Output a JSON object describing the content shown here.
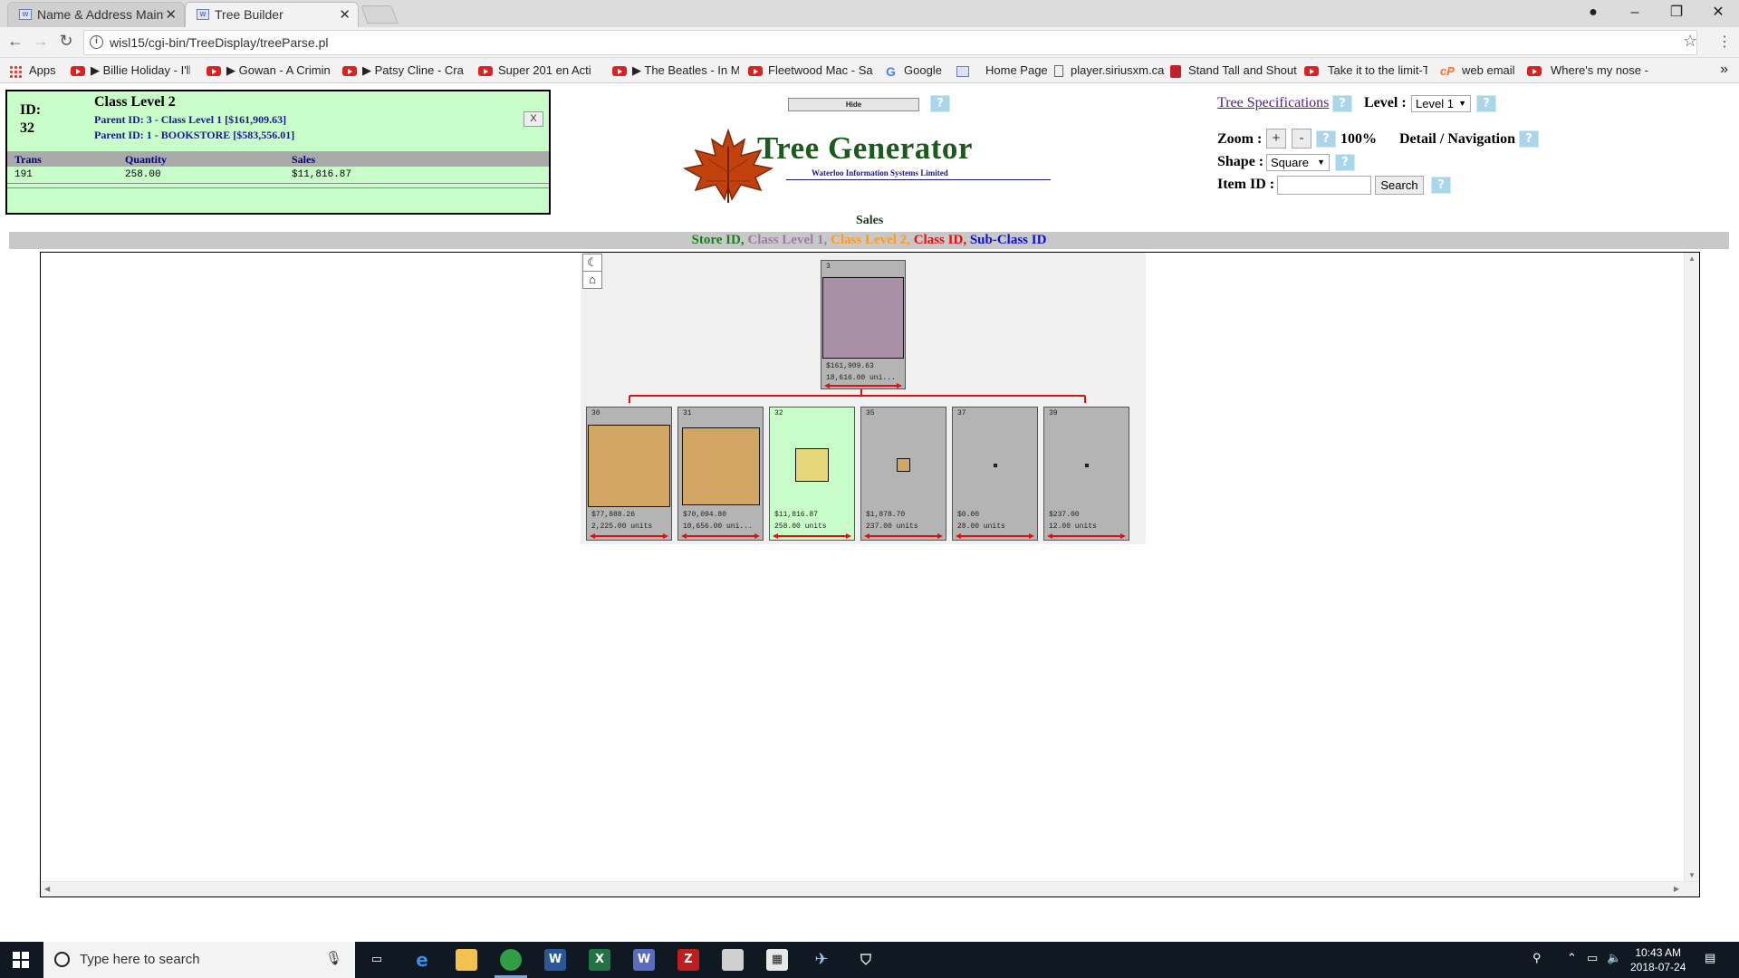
{
  "browser": {
    "tabs": [
      {
        "label": "Name & Address Mainte",
        "icon": "wisl-icon",
        "close": "✕"
      },
      {
        "label": "Tree Builder",
        "icon": "wisl-icon",
        "close": "✕"
      }
    ],
    "url": "wisl15/cgi-bin/TreeDisplay/treeParse.pl",
    "bookmarks": [
      {
        "label": "Apps",
        "icon": "apps-icon"
      },
      {
        "label": "▶ Billie Holiday - I'll",
        "icon": "youtube-icon"
      },
      {
        "label": "▶ Gowan - A Crimin",
        "icon": "youtube-icon"
      },
      {
        "label": "▶ Patsy Cline - Craz",
        "icon": "youtube-icon"
      },
      {
        "label": "Super 201 en Acti",
        "icon": "youtube-icon"
      },
      {
        "label": "▶ The Beatles - In M",
        "icon": "youtube-icon"
      },
      {
        "label": "Fleetwood Mac - Sa",
        "icon": "youtube-icon"
      },
      {
        "label": "Google",
        "icon": "google-icon"
      },
      {
        "label": "Home Page",
        "icon": "wisl-icon"
      },
      {
        "label": "player.siriusxm.ca",
        "icon": "document-icon"
      },
      {
        "label": "Stand Tall and Shout",
        "icon": "ribbon-icon"
      },
      {
        "label": "Take it to the limit-T",
        "icon": "youtube-icon"
      },
      {
        "label": "web email",
        "icon": "cpanel-icon"
      },
      {
        "label": "Where's my nose - Y",
        "icon": "youtube-icon"
      }
    ]
  },
  "info": {
    "id_label": "ID:",
    "id_value": "32",
    "title": "Class Level 2",
    "parent1": "Parent ID: 3 - Class Level 1 [$161,909.63]",
    "parent2": "Parent ID: 1 - BOOKSTORE [$583,556.01]",
    "close": "X",
    "columns": [
      "Trans",
      "Quantity",
      "Sales"
    ],
    "row": [
      "191",
      "258.00",
      "$11,816.87"
    ]
  },
  "controls": {
    "hide": "Hide",
    "help": "?",
    "tree_spec": "Tree Specifications",
    "level_label": "Level :",
    "level_value": "Level 1",
    "zoom_label": "Zoom :",
    "zoom_plus": "+",
    "zoom_minus": "-",
    "zoom_value": "100%",
    "detail_nav": "Detail / Navigation",
    "shape_label": "Shape :",
    "shape_value": "Square",
    "item_label": "Item ID :",
    "item_value": "",
    "search": "Search"
  },
  "logo": {
    "name": "Tree Generator",
    "sub": "Waterloo Information Systems Limited"
  },
  "metric_label": "Sales",
  "legend": [
    {
      "text": "Store ID",
      "color": "#1e7b1e"
    },
    {
      "text": "Class Level 1",
      "color": "#9a7fa0"
    },
    {
      "text": "Class Level 2",
      "color": "#ff9a1a"
    },
    {
      "text": "Class ID",
      "color": "#e01010"
    },
    {
      "text": "Sub-Class ID",
      "color": "#1010c8"
    }
  ],
  "tree": {
    "root": {
      "id": "3",
      "sales": "$161,909.63",
      "units": "18,616.00 uni...",
      "color": "#a891a6"
    },
    "children": [
      {
        "id": "30",
        "sales": "$77,888.26",
        "units": "2,225.00 units",
        "color": "#d2a766",
        "size": 1.0,
        "selected": false
      },
      {
        "id": "31",
        "sales": "$70,094.80",
        "units": "10,656.00 uni...",
        "color": "#d2a766",
        "size": 0.95,
        "selected": false
      },
      {
        "id": "32",
        "sales": "$11,816.87",
        "units": "258.00 units",
        "color": "#e6d77a",
        "size": 0.4,
        "selected": true
      },
      {
        "id": "35",
        "sales": "$1,878.70",
        "units": "237.00 units",
        "color": "#d2a766",
        "size": 0.16,
        "selected": false
      },
      {
        "id": "37",
        "sales": "$0.00",
        "units": "28.00 units",
        "color": "#333333",
        "size": 0.05,
        "selected": false
      },
      {
        "id": "39",
        "sales": "$237.00",
        "units": "12.00 units",
        "color": "#333333",
        "size": 0.05,
        "selected": false
      }
    ]
  },
  "taskbar": {
    "search_placeholder": "Type here to search",
    "time": "10:43 AM",
    "date": "2018-07-24"
  }
}
